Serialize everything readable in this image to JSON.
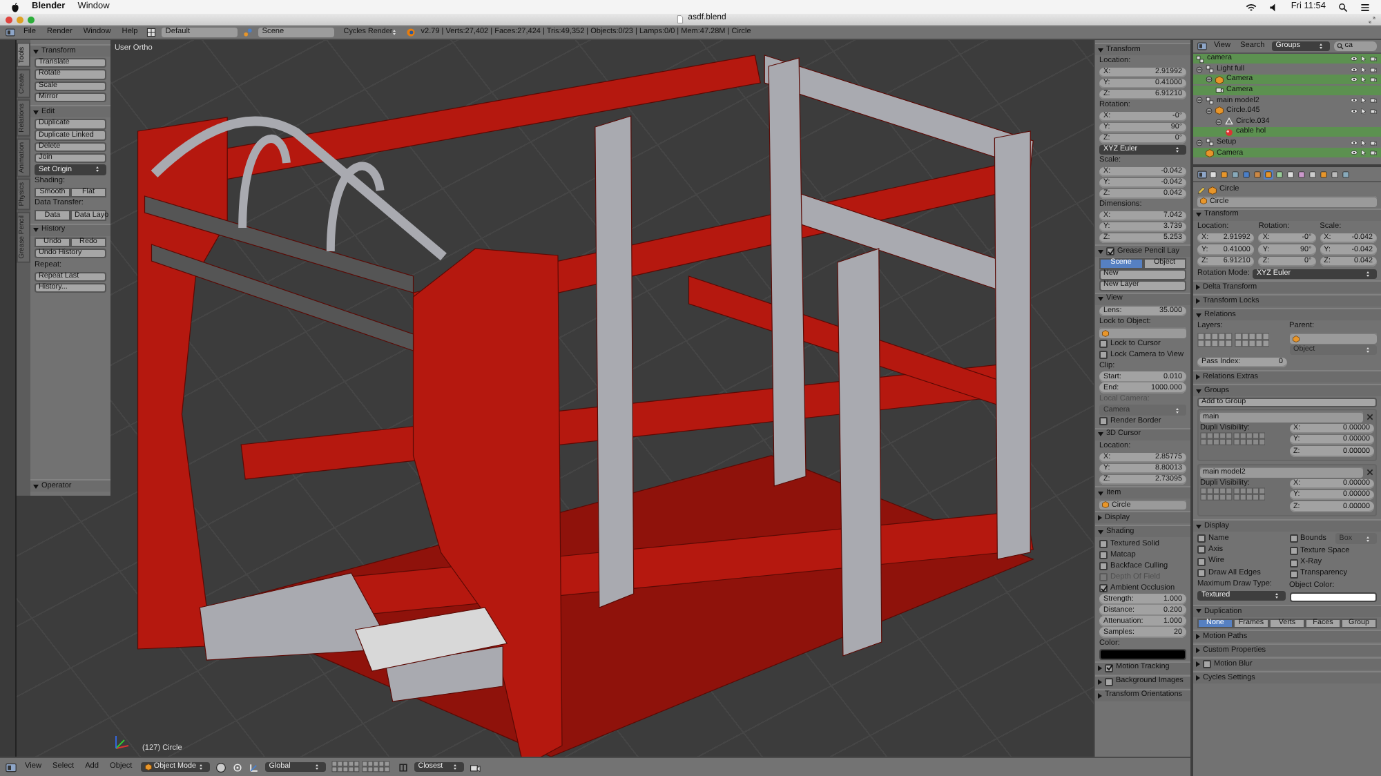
{
  "menubar": {
    "app": "Blender",
    "menus": [
      "Window"
    ],
    "clock": "Fri 11:54"
  },
  "window": {
    "title": "asdf.blend"
  },
  "info_header": {
    "menus": [
      "File",
      "Render",
      "Window",
      "Help"
    ],
    "layout": "Default",
    "scene": "Scene",
    "engine": "Cycles Render",
    "stats": "v2.79 | Verts:27,402 | Faces:27,424 | Tris:49,352 | Objects:0/23 | Lamps:0/0 | Mem:47.28M | Circle"
  },
  "tool_tabs": [
    {
      "label": "Tools",
      "selected": true
    },
    {
      "label": "Create",
      "selected": false
    },
    {
      "label": "Relations",
      "selected": false
    },
    {
      "label": "Animation",
      "selected": false
    },
    {
      "label": "Physics",
      "selected": false
    },
    {
      "label": "Grease Pencil",
      "selected": false
    }
  ],
  "tool_shelf": {
    "rows": [
      {
        "kind": "section",
        "label": "Transform",
        "expanded": true
      },
      {
        "kind": "button",
        "label": "Translate"
      },
      {
        "kind": "button",
        "label": "Rotate"
      },
      {
        "kind": "button",
        "label": "Scale"
      },
      {
        "kind": "button",
        "label": "Mirror"
      },
      {
        "kind": "section",
        "label": "Edit",
        "expanded": true
      },
      {
        "kind": "button",
        "label": "Duplicate"
      },
      {
        "kind": "button",
        "label": "Duplicate Linked"
      },
      {
        "kind": "button",
        "label": "Delete"
      },
      {
        "kind": "button",
        "label": "Join"
      },
      {
        "kind": "dropdown",
        "value": "Set Origin"
      },
      {
        "kind": "label",
        "label": "Shading:"
      },
      {
        "kind": "buttons",
        "items": [
          "Smooth",
          "Flat"
        ]
      },
      {
        "kind": "label",
        "label": "Data Transfer:"
      },
      {
        "kind": "buttons",
        "items": [
          "Data",
          "Data Layo"
        ]
      },
      {
        "kind": "section",
        "label": "History",
        "expanded": true
      },
      {
        "kind": "buttons",
        "items": [
          "Undo",
          "Redo"
        ]
      },
      {
        "kind": "button",
        "label": "Undo History"
      },
      {
        "kind": "label",
        "label": "Repeat:"
      },
      {
        "kind": "button",
        "label": "Repeat Last"
      },
      {
        "kind": "button",
        "label": "History..."
      }
    ],
    "footer": [
      {
        "kind": "section",
        "label": "Operator",
        "expanded": true
      }
    ]
  },
  "viewport": {
    "view_name": "User Ortho",
    "object_label": "(127) Circle"
  },
  "n_panel": {
    "rows": [
      {
        "kind": "section",
        "label": "Transform",
        "expanded": true
      },
      {
        "kind": "label",
        "label": "Location:"
      },
      {
        "kind": "num",
        "label": "X:",
        "value": "2.91992"
      },
      {
        "kind": "num",
        "label": "Y:",
        "value": "0.41000"
      },
      {
        "kind": "num",
        "label": "Z:",
        "value": "6.91210"
      },
      {
        "kind": "label",
        "label": "Rotation:"
      },
      {
        "kind": "num",
        "label": "X:",
        "value": "-0°"
      },
      {
        "kind": "num",
        "label": "Y:",
        "value": "90°"
      },
      {
        "kind": "num",
        "label": "Z:",
        "value": "0°"
      },
      {
        "kind": "dropdown",
        "value": "XYZ Euler"
      },
      {
        "kind": "label",
        "label": "Scale:"
      },
      {
        "kind": "num",
        "label": "X:",
        "value": "-0.042"
      },
      {
        "kind": "num",
        "label": "Y:",
        "value": "-0.042"
      },
      {
        "kind": "num",
        "label": "Z:",
        "value": "0.042"
      },
      {
        "kind": "label",
        "label": "Dimensions:"
      },
      {
        "kind": "num",
        "label": "X:",
        "value": "7.042"
      },
      {
        "kind": "num",
        "label": "Y:",
        "value": "3.739"
      },
      {
        "kind": "num",
        "label": "Z:",
        "value": "5.253"
      },
      {
        "kind": "section",
        "label": "Grease Pencil Lay",
        "expanded": true,
        "checked": true
      },
      {
        "kind": "segmented",
        "items": [
          {
            "label": "Scene",
            "selected": true
          },
          {
            "label": "Object",
            "selected": false
          }
        ]
      },
      {
        "kind": "button",
        "label": "New"
      },
      {
        "kind": "button",
        "label": "New Layer"
      },
      {
        "kind": "section",
        "label": "View",
        "expanded": true
      },
      {
        "kind": "num",
        "label": "Lens:",
        "value": "35.000"
      },
      {
        "kind": "label",
        "label": "Lock to Object:"
      },
      {
        "kind": "objfield"
      },
      {
        "kind": "check",
        "label": "Lock to Cursor",
        "checked": false
      },
      {
        "kind": "check",
        "label": "Lock Camera to View",
        "checked": false
      },
      {
        "kind": "label",
        "label": "Clip:"
      },
      {
        "kind": "num",
        "label": "Start:",
        "value": "0.010"
      },
      {
        "kind": "num",
        "label": "End:",
        "value": "1000.000"
      },
      {
        "kind": "label",
        "label": "Local Camera:",
        "disabled": true
      },
      {
        "kind": "dropdown",
        "value": "Camera",
        "disabled": true
      },
      {
        "kind": "check",
        "label": "Render Border",
        "checked": false
      },
      {
        "kind": "section",
        "label": "3D Cursor",
        "expanded": true
      },
      {
        "kind": "label",
        "label": "Location:"
      },
      {
        "kind": "num",
        "label": "X:",
        "value": "2.85775"
      },
      {
        "kind": "num",
        "label": "Y:",
        "value": "8.80013"
      },
      {
        "kind": "num",
        "label": "Z:",
        "value": "2.73095"
      },
      {
        "kind": "section",
        "label": "Item",
        "expanded": true
      },
      {
        "kind": "objfield",
        "value": "Circle"
      },
      {
        "kind": "section",
        "label": "Display",
        "expanded": false
      },
      {
        "kind": "section",
        "label": "Shading",
        "expanded": true
      },
      {
        "kind": "check",
        "label": "Textured Solid",
        "checked": false
      },
      {
        "kind": "check",
        "label": "Matcap",
        "checked": false
      },
      {
        "kind": "check",
        "label": "Backface Culling",
        "checked": false
      },
      {
        "kind": "check",
        "label": "Depth Of Field",
        "checked": false,
        "disabled": true
      },
      {
        "kind": "check",
        "label": "Ambient Occlusion",
        "checked": true
      },
      {
        "kind": "num",
        "label": "Strength:",
        "value": "1.000"
      },
      {
        "kind": "num",
        "label": "Distance:",
        "value": "0.200"
      },
      {
        "kind": "num",
        "label": "Attenuation:",
        "value": "1.000"
      },
      {
        "kind": "num",
        "label": "Samples:",
        "value": "20"
      },
      {
        "kind": "label",
        "label": "Color:"
      },
      {
        "kind": "color",
        "color": "#000000"
      },
      {
        "kind": "section",
        "label": "Motion Tracking",
        "expanded": false,
        "checked": true
      },
      {
        "kind": "section",
        "label": "Background Images",
        "expanded": false,
        "checked": false
      },
      {
        "kind": "section",
        "label": "Transform Orientations",
        "expanded": false
      }
    ]
  },
  "outliner": {
    "menus": [
      "View",
      "Search"
    ],
    "display_mode": "Groups",
    "search": "ca",
    "items": [
      {
        "label": "camera",
        "kind": "group",
        "matched": true
      },
      {
        "label": "Light full",
        "kind": "group",
        "matched": false,
        "children": [
          {
            "label": "Camera",
            "kind": "object",
            "matched": true,
            "children": [
              {
                "label": "Camera",
                "kind": "camera",
                "matched": true
              }
            ]
          }
        ]
      },
      {
        "label": "main model2",
        "kind": "group",
        "matched": false,
        "children": [
          {
            "label": "Circle.045",
            "kind": "object",
            "matched": false,
            "children": [
              {
                "label": "Circle.034",
                "kind": "mesh",
                "matched": false,
                "children": [
                  {
                    "label": "cable hol",
                    "kind": "material",
                    "matched": true
                  }
                ]
              }
            ]
          }
        ]
      },
      {
        "label": "Setup",
        "kind": "group",
        "matched": false,
        "children": [
          {
            "label": "Camera",
            "kind": "object",
            "matched": true
          }
        ]
      }
    ]
  },
  "properties": {
    "tabs": [
      {
        "selected": false
      },
      {
        "selected": false
      },
      {
        "selected": false
      },
      {
        "selected": false
      },
      {
        "selected": false
      },
      {
        "selected": true
      },
      {
        "selected": false
      },
      {
        "selected": false
      },
      {
        "selected": false
      },
      {
        "selected": false
      },
      {
        "selected": false
      },
      {
        "selected": false
      },
      {
        "selected": false
      }
    ],
    "rows": [
      {
        "kind": "breadcrumb",
        "label": "Circle"
      },
      {
        "kind": "objfield",
        "value": "Circle"
      },
      {
        "kind": "section",
        "label": "Transform",
        "expanded": true
      },
      {
        "kind": "cols",
        "cols": [
          [
            {
              "kind": "label",
              "label": "Location:"
            },
            {
              "kind": "num",
              "label": "X:",
              "value": "2.91992"
            },
            {
              "kind": "num",
              "label": "Y:",
              "value": "0.41000"
            },
            {
              "kind": "num",
              "label": "Z:",
              "value": "6.91210"
            }
          ],
          [
            {
              "kind": "label",
              "label": "Rotation:"
            },
            {
              "kind": "num",
              "label": "X:",
              "value": "-0°"
            },
            {
              "kind": "num",
              "label": "Y:",
              "value": "90°"
            },
            {
              "kind": "num",
              "label": "Z:",
              "value": "0°"
            }
          ],
          [
            {
              "kind": "label",
              "label": "Scale:"
            },
            {
              "kind": "num",
              "label": "X:",
              "value": "-0.042"
            },
            {
              "kind": "num",
              "label": "Y:",
              "value": "-0.042"
            },
            {
              "kind": "num",
              "label": "Z:",
              "value": "0.042"
            }
          ]
        ]
      },
      {
        "kind": "labeled_dropdown",
        "label": "Rotation Mode:",
        "value": "XYZ Euler"
      },
      {
        "kind": "section",
        "label": "Delta Transform",
        "expanded": false
      },
      {
        "kind": "section",
        "label": "Transform Locks",
        "expanded": false
      },
      {
        "kind": "section",
        "label": "Relations",
        "expanded": true
      },
      {
        "kind": "cols",
        "cols": [
          [
            {
              "kind": "label",
              "label": "Layers:"
            },
            {
              "kind": "layers"
            }
          ],
          [
            {
              "kind": "label",
              "label": "Parent:"
            },
            {
              "kind": "objfield"
            },
            {
              "kind": "dropdown",
              "placeholder": "Object",
              "disabled": true
            }
          ]
        ]
      },
      {
        "kind": "cols",
        "cols": [
          [
            {
              "kind": "num",
              "label": "Pass Index:",
              "value": "0"
            }
          ]
        ]
      },
      {
        "kind": "section",
        "label": "Relations Extras",
        "expanded": false
      },
      {
        "kind": "section",
        "label": "Groups",
        "expanded": true
      },
      {
        "kind": "button",
        "label": "Add to Group"
      },
      {
        "kind": "group",
        "name": "main",
        "label": "Dupli Visibility:",
        "fields": [
          {
            "label": "X:",
            "value": "0.00000"
          },
          {
            "label": "Y:",
            "value": "0.00000"
          },
          {
            "label": "Z:",
            "value": "0.00000"
          }
        ]
      },
      {
        "kind": "group",
        "name": "main model2",
        "label": "Dupli Visibility:",
        "fields": [
          {
            "label": "X:",
            "value": "0.00000"
          },
          {
            "label": "Y:",
            "value": "0.00000"
          },
          {
            "label": "Z:",
            "value": "0.00000"
          }
        ]
      },
      {
        "kind": "section",
        "label": "Display",
        "expanded": true
      },
      {
        "kind": "cols",
        "cols": [
          [
            {
              "kind": "check",
              "label": "Name",
              "checked": false
            },
            {
              "kind": "check",
              "label": "Axis",
              "checked": false
            },
            {
              "kind": "check",
              "label": "Wire",
              "checked": false
            },
            {
              "kind": "check",
              "label": "Draw All Edges",
              "checked": false
            },
            {
              "kind": "label",
              "label": "Maximum Draw Type:"
            },
            {
              "kind": "dropdown",
              "value": "Textured"
            }
          ],
          [
            {
              "kind": "cols",
              "cols": [
                [
                  {
                    "kind": "check",
                    "label": "Bounds",
                    "checked": false
                  }
                ],
                [
                  {
                    "kind": "dropdown",
                    "value": "Box",
                    "disabled": true
                  }
                ]
              ]
            },
            {
              "kind": "check",
              "label": "Texture Space",
              "checked": false
            },
            {
              "kind": "check",
              "label": "X-Ray",
              "checked": false
            },
            {
              "kind": "check",
              "label": "Transparency",
              "checked": false
            },
            {
              "kind": "label",
              "label": "Object Color:"
            },
            {
              "kind": "color",
              "color": "#ffffff"
            }
          ]
        ]
      },
      {
        "kind": "section",
        "label": "Duplication",
        "expanded": true
      },
      {
        "kind": "segmented",
        "items": [
          {
            "label": "None",
            "selected": true
          },
          {
            "label": "Frames",
            "selected": false
          },
          {
            "label": "Verts",
            "selected": false
          },
          {
            "label": "Faces",
            "selected": false
          },
          {
            "label": "Group",
            "selected": false
          }
        ]
      },
      {
        "kind": "section",
        "label": "Motion Paths",
        "expanded": false
      },
      {
        "kind": "section",
        "label": "Custom Properties",
        "expanded": false
      },
      {
        "kind": "section",
        "label": "Motion Blur",
        "expanded": false,
        "checked": false
      },
      {
        "kind": "section",
        "label": "Cycles Settings",
        "expanded": false
      }
    ]
  },
  "bottom_header": {
    "menus": [
      "View",
      "Select",
      "Add",
      "Object"
    ],
    "mode": "Object Mode",
    "orientation": "Global",
    "snap": "Closest"
  }
}
